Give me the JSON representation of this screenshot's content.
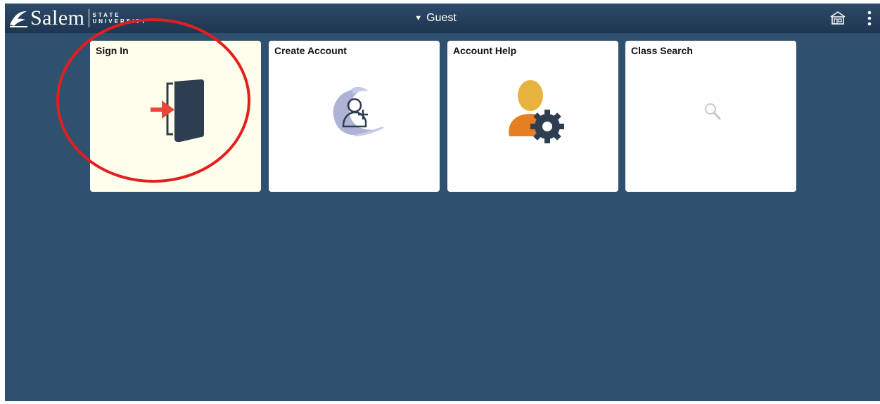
{
  "header": {
    "brand_name": "Salem",
    "brand_sub_1": "STATE",
    "brand_sub_2": "UNIVERSITY",
    "title": "Guest",
    "home_icon": "home-icon",
    "menu_icon": "vertical-dots-icon"
  },
  "tiles": [
    {
      "label": "Sign In",
      "icon": "door-enter-icon"
    },
    {
      "label": "Create Account",
      "icon": "add-user-icon"
    },
    {
      "label": "Account Help",
      "icon": "user-gear-icon"
    },
    {
      "label": "Class Search",
      "icon": "magnifier-icon"
    }
  ],
  "colors": {
    "background": "#2f506e",
    "header": "#1e3651",
    "signin_tile": "#fffdeb",
    "tile": "#ffffff",
    "highlight": "#e41e1e"
  }
}
